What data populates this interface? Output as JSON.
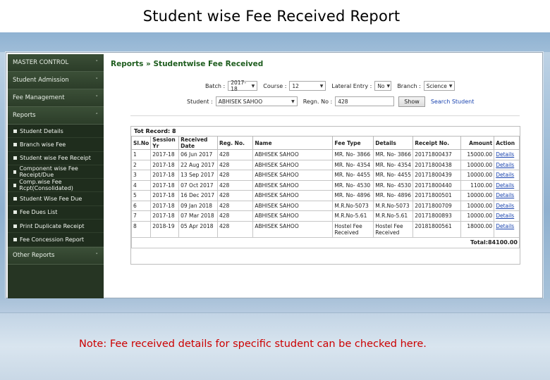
{
  "slide_title": "Student wise Fee Received Report",
  "note": "Note: Fee received details for specific student can be checked here.",
  "sidebar": {
    "sections": [
      {
        "label": "MASTER CONTROL",
        "chevron": "˅"
      },
      {
        "label": "Student Admission",
        "chevron": "˅"
      },
      {
        "label": "Fee Management",
        "chevron": "˅"
      },
      {
        "label": "Reports",
        "chevron": "˄"
      }
    ],
    "report_items": [
      "Student Details",
      "Branch wise Fee",
      "Student wise Fee Receipt",
      "Component wise Fee Receipt/Due",
      "Comp.wise Fee Rcpt(Consolidated)",
      "Student Wise Fee Due",
      "Fee Dues List",
      "Print Duplicate Receipt",
      "Fee Concession Report"
    ],
    "other": {
      "label": "Other Reports",
      "chevron": "˅"
    }
  },
  "breadcrumb": {
    "root": "Reports",
    "sep": " » ",
    "current": "Studentwise Fee Received"
  },
  "filters": {
    "batch_label": "Batch :",
    "batch_value": "2017-18",
    "course_label": "Course :",
    "course_value": "12",
    "lateral_label": "Lateral Entry :",
    "lateral_value": "No",
    "branch_label": "Branch :",
    "branch_value": "Science",
    "student_label": "Student :",
    "student_value": "ABHISEK SAHOO",
    "regn_label": "Regn. No :",
    "regn_value": "428",
    "show_label": "Show",
    "search_label": "Search Student"
  },
  "grid": {
    "total_record": "Tot Record: 8",
    "columns": [
      "Sl.No",
      "Session Yr",
      "Received Date",
      "Reg. No.",
      "Name",
      "Fee Type",
      "Details",
      "Receipt No.",
      "Amount",
      "Action"
    ],
    "rows": [
      [
        "1",
        "2017-18",
        "06 Jun 2017",
        "428",
        "ABHISEK SAHOO",
        "MR. No- 3866",
        "MR. No- 3866",
        "20171800437",
        "15000.00",
        "Details"
      ],
      [
        "2",
        "2017-18",
        "22 Aug 2017",
        "428",
        "ABHISEK SAHOO",
        "MR. No- 4354",
        "MR. No- 4354",
        "20171800438",
        "10000.00",
        "Details"
      ],
      [
        "3",
        "2017-18",
        "13 Sep 2017",
        "428",
        "ABHISEK SAHOO",
        "MR. No- 4455",
        "MR. No- 4455",
        "20171800439",
        "10000.00",
        "Details"
      ],
      [
        "4",
        "2017-18",
        "07 Oct 2017",
        "428",
        "ABHISEK SAHOO",
        "MR. No- 4530",
        "MR. No- 4530",
        "20171800440",
        "1100.00",
        "Details"
      ],
      [
        "5",
        "2017-18",
        "16 Dec 2017",
        "428",
        "ABHISEK SAHOO",
        "MR. No- 4896",
        "MR. No- 4896",
        "20171800501",
        "10000.00",
        "Details"
      ],
      [
        "6",
        "2017-18",
        "09 Jan 2018",
        "428",
        "ABHISEK SAHOO",
        "M.R.No-5073",
        "M.R.No-5073",
        "20171800709",
        "10000.00",
        "Details"
      ],
      [
        "7",
        "2017-18",
        "07 Mar 2018",
        "428",
        "ABHISEK SAHOO",
        "M.R.No-5.61",
        "M.R.No-5.61",
        "20171800893",
        "10000.00",
        "Details"
      ],
      [
        "8",
        "2018-19",
        "05 Apr 2018",
        "428",
        "ABHISEK SAHOO",
        "Hostel Fee Received",
        "Hostel Fee Received",
        "20181800561",
        "18000.00",
        "Details"
      ]
    ],
    "grand_total": "Total:84100.00"
  }
}
